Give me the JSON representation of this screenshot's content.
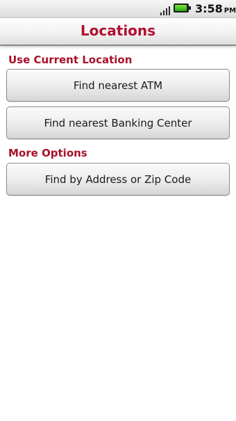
{
  "status_bar": {
    "time": "3:58",
    "ampm": "PM",
    "icons": [
      "signal-icon",
      "battery-icon"
    ],
    "battery_level_fraction": 0.95
  },
  "header": {
    "title": "Locations"
  },
  "sections": [
    {
      "title": "Use Current Location",
      "buttons": [
        {
          "label": "Find nearest ATM"
        },
        {
          "label": "Find nearest Banking Center"
        }
      ]
    },
    {
      "title": "More Options",
      "buttons": [
        {
          "label": "Find by Address or Zip Code"
        }
      ]
    }
  ],
  "colors": {
    "accent": "#b0112f"
  }
}
